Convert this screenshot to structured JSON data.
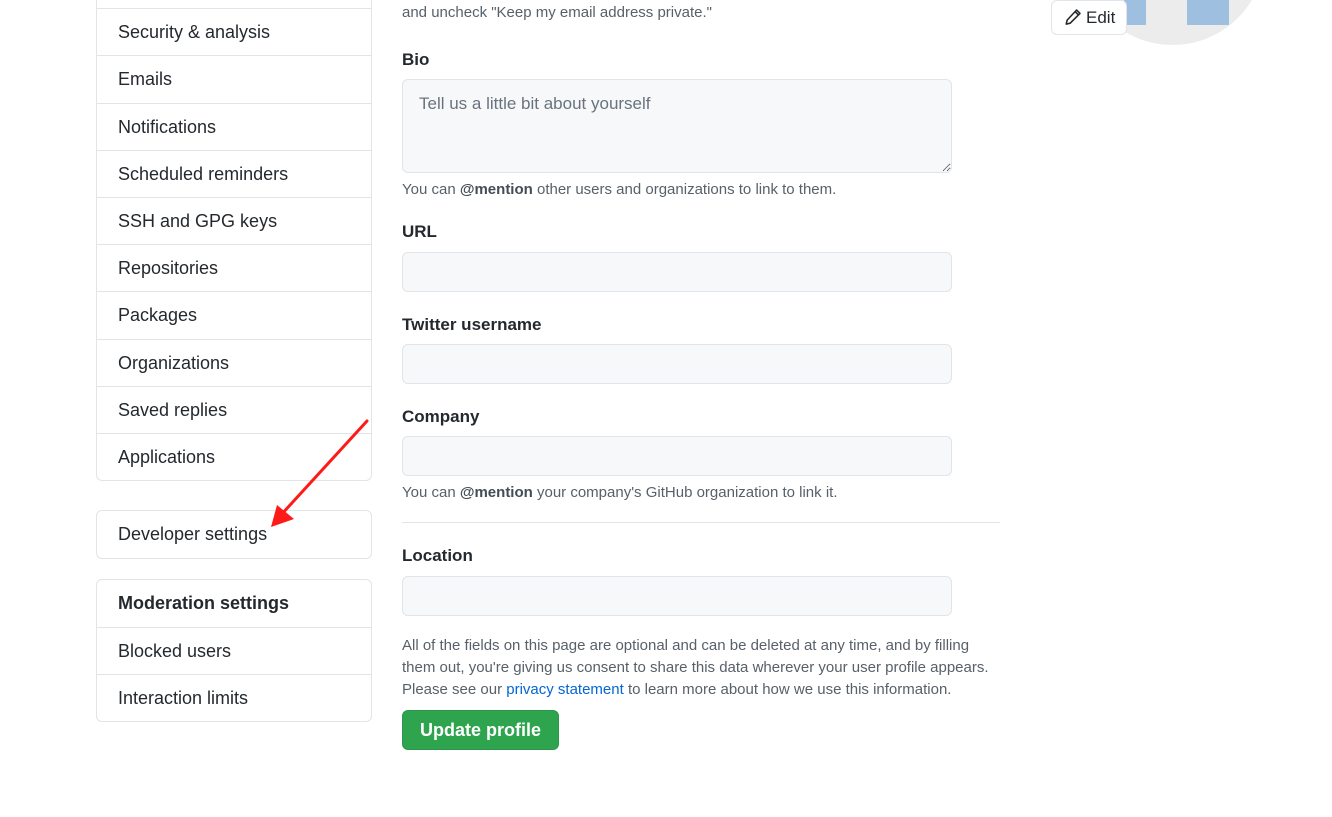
{
  "sidebar": {
    "main_items": [
      "Security & analysis",
      "Emails",
      "Notifications",
      "Scheduled reminders",
      "SSH and GPG keys",
      "Repositories",
      "Packages",
      "Organizations",
      "Saved replies",
      "Applications"
    ],
    "developer_settings": "Developer settings",
    "moderation": {
      "header": "Moderation settings",
      "items": [
        "Blocked users",
        "Interaction limits"
      ]
    }
  },
  "form": {
    "top_note": "and uncheck \"Keep my email address private.\"",
    "bio": {
      "label": "Bio",
      "placeholder": "Tell us a little bit about yourself",
      "note_prefix": "You can ",
      "note_bold": "@mention",
      "note_suffix": " other users and organizations to link to them."
    },
    "url": {
      "label": "URL",
      "value": ""
    },
    "twitter": {
      "label": "Twitter username",
      "value": ""
    },
    "company": {
      "label": "Company",
      "value": "",
      "note_prefix": "You can ",
      "note_bold": "@mention",
      "note_suffix": " your company's GitHub organization to link it."
    },
    "location": {
      "label": "Location",
      "value": ""
    },
    "disclaimer_prefix": "All of the fields on this page are optional and can be deleted at any time, and by filling them out, you're giving us consent to share this data wherever your user profile appears. Please see our ",
    "disclaimer_link": "privacy statement",
    "disclaimer_suffix": " to learn more about how we use this information.",
    "submit_label": "Update profile"
  },
  "avatar": {
    "edit_label": "Edit",
    "edit_icon": "pencil-icon"
  },
  "annotation": {
    "arrow_color": "#ff1a1a"
  }
}
